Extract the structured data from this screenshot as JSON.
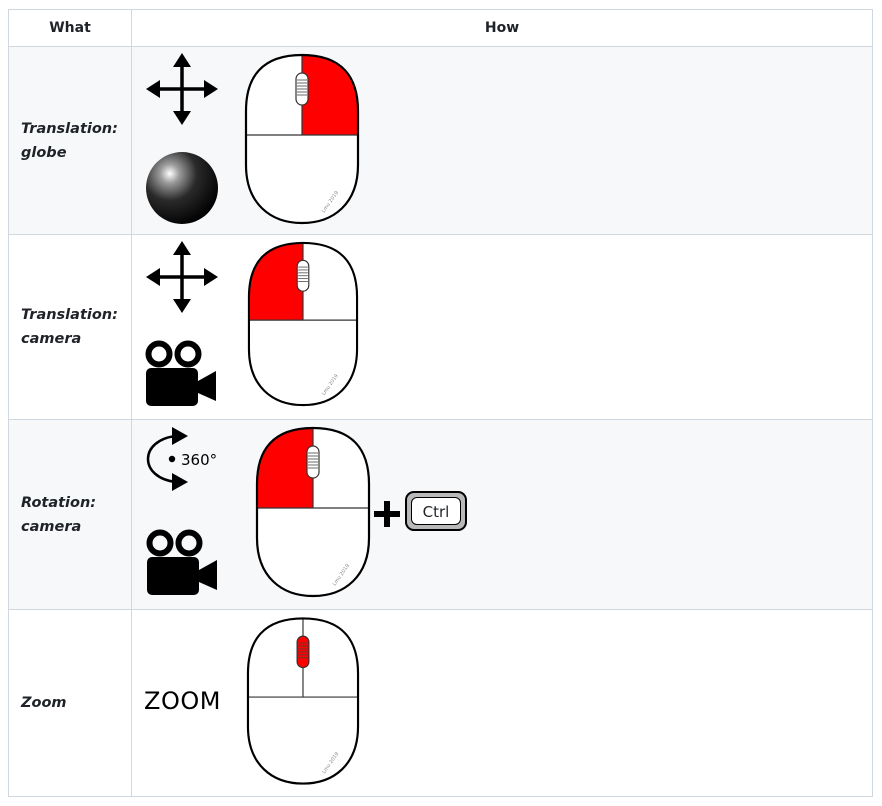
{
  "table": {
    "headers": {
      "what": "What",
      "how": "How"
    },
    "rows": [
      {
        "what_line1": "Translation:",
        "what_line2": "globe",
        "mouse_button": "right",
        "extra_icon": "move-arrows-icon",
        "subject_icon": "globe-sphere-icon"
      },
      {
        "what_line1": "Translation:",
        "what_line2": "camera",
        "mouse_button": "left",
        "extra_icon": "move-arrows-icon",
        "subject_icon": "video-camera-icon"
      },
      {
        "what_line1": "Rotation:",
        "what_line2": "camera",
        "mouse_button": "left",
        "extra_icon": "rotate-arrow-icon",
        "subject_icon": "video-camera-icon",
        "rotation_label": "360°",
        "modifier_key": "Ctrl"
      },
      {
        "what_line1": "Zoom",
        "what_line2": "",
        "mouse_button": "wheel",
        "zoom_label": "ZOOM"
      }
    ]
  },
  "colors": {
    "highlight": "#ff0000",
    "row_alt": "#f6f8fa",
    "border": "#d0d7de"
  }
}
